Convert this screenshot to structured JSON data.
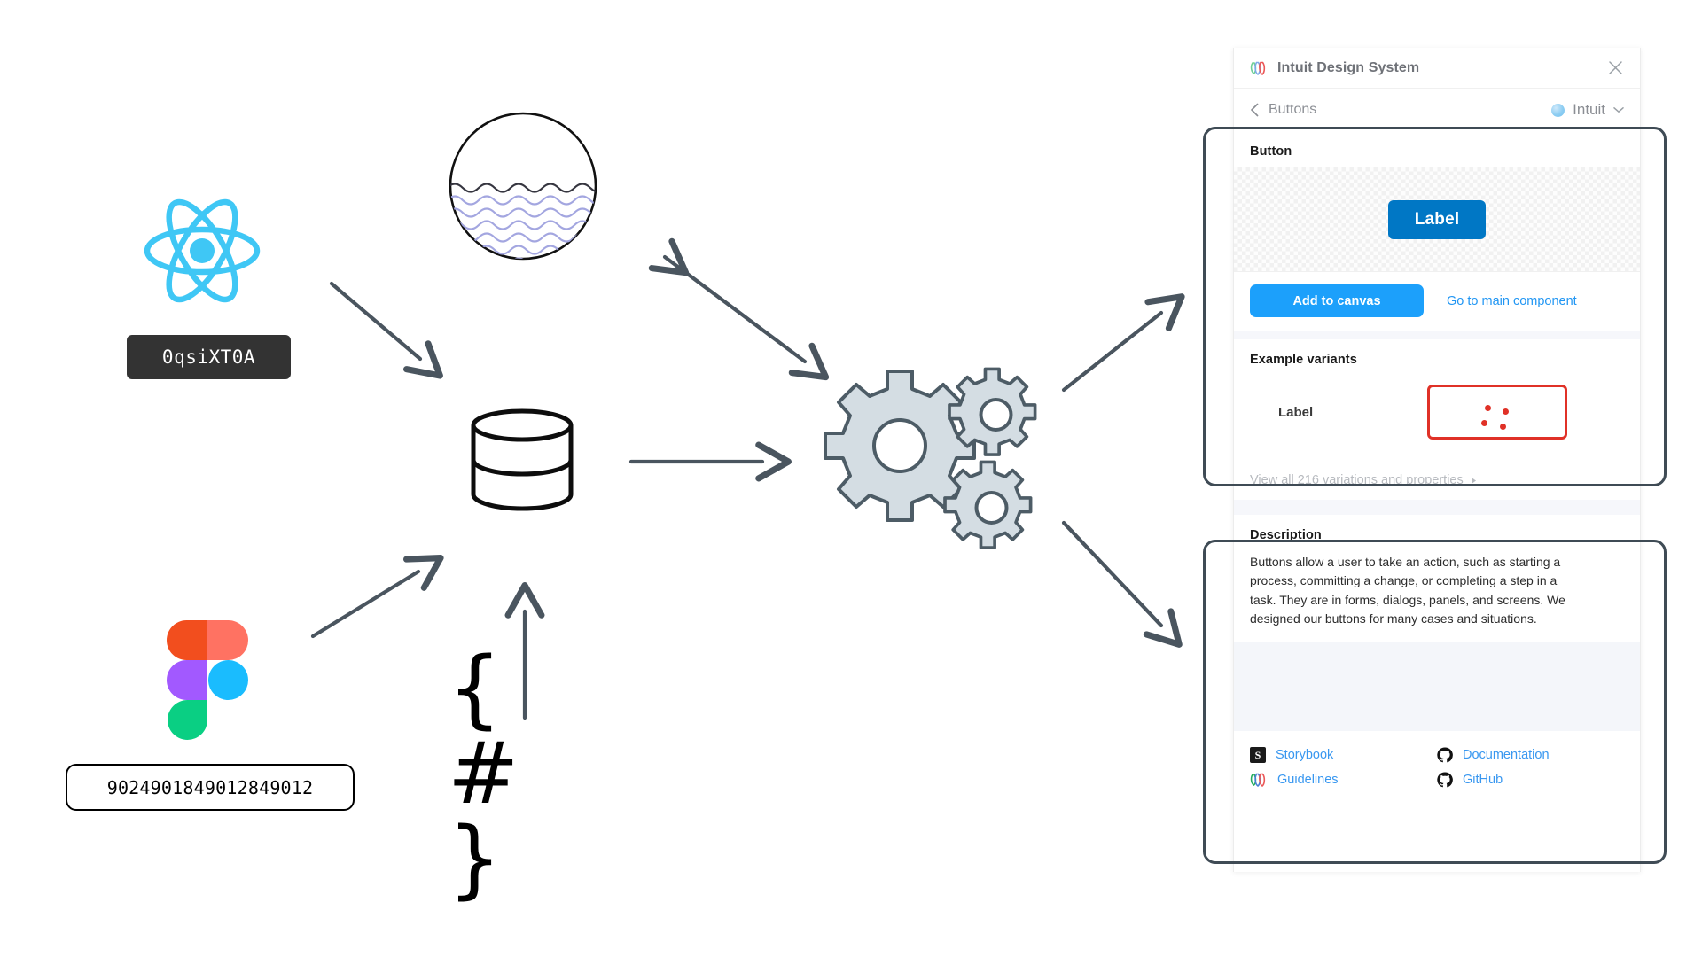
{
  "canvas": {
    "react_logo_alt": "react-logo",
    "code_badge_value": "0qsiXT0A",
    "figma_logo_alt": "figma-logo",
    "number_pill_value": "9024901849012849012",
    "water_circle_alt": "water-circle",
    "database_alt": "database-cylinder",
    "json_glyph": "{ # }",
    "gears_alt": "gears-cluster"
  },
  "panel": {
    "title": "Intuit Design System",
    "close_icon": "close-icon",
    "logo_icon": "intuit-logo-icon",
    "breadcrumb": {
      "back_icon": "chevron-left-icon",
      "label": "Buttons"
    },
    "brand": {
      "label": "Intuit",
      "chevron_icon": "chevron-down-icon",
      "dot_color": "#8dcdf2"
    },
    "component": {
      "section_title": "Button",
      "preview_button_label": "Label",
      "preview_button_color": "#0077c5",
      "add_to_canvas_label": "Add to canvas",
      "add_to_canvas_color": "#1ca0fb",
      "go_to_main_label": "Go to main component",
      "go_to_main_color": "#2196f3"
    },
    "variants": {
      "section_title": "Example variants",
      "rows": [
        {
          "name": "Label",
          "highlight_color": "#e03127",
          "dot_count": 4
        }
      ],
      "view_all_label": "View all 216 variations and properties",
      "view_all_count": 216,
      "view_all_arrow_icon": "caret-right-icon"
    },
    "description": {
      "section_title": "Description",
      "body": "Buttons allow a user to take an action, such as starting a process, committing a change, or completing a step in a task. They are in forms, dialogs, panels, and screens. We designed our buttons for many cases and situations."
    },
    "links": [
      {
        "label": "Storybook",
        "icon": "storybook-icon",
        "color": "#3897f0"
      },
      {
        "label": "Documentation",
        "icon": "github-icon",
        "color": "#3897f0"
      },
      {
        "label": "Guidelines",
        "icon": "intuit-logo-icon",
        "color": "#3897f0"
      },
      {
        "label": "GitHub",
        "icon": "github-icon",
        "color": "#3897f0"
      }
    ]
  },
  "annotations": {
    "stroke_color": "#3f4b55",
    "boxes": [
      "component-card-highlight",
      "description-card-highlight"
    ]
  },
  "arrows": {
    "stroke_color": "#4a555f",
    "items": [
      "react-to-database",
      "figma-to-database",
      "json-to-database",
      "database-to-gears",
      "water-to-gears-bidirectional",
      "gears-to-component-card",
      "gears-to-description-card"
    ]
  }
}
